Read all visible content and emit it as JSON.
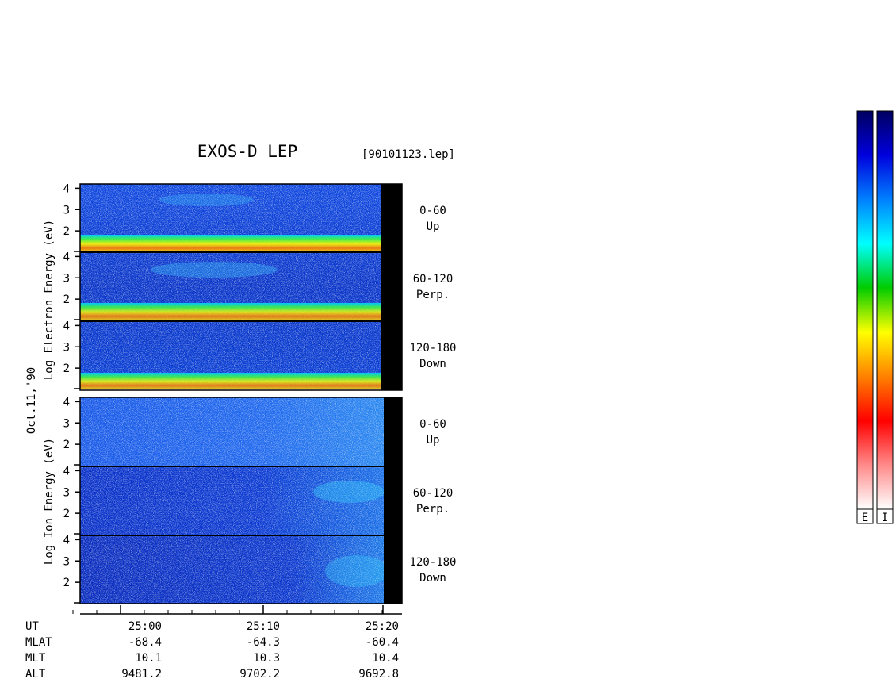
{
  "title": "EXOS-D LEP",
  "file_id": "[90101123.lep]",
  "date_label": "Oct.11,'90",
  "electron_ylabel": "Log Electron Energy (eV)",
  "ion_ylabel": "Log Ion Energy (eV)",
  "panels": [
    {
      "species": "electron",
      "pitch": "0-60",
      "direction": "Up"
    },
    {
      "species": "electron",
      "pitch": "60-120",
      "direction": "Perp."
    },
    {
      "species": "electron",
      "pitch": "120-180",
      "direction": "Down"
    },
    {
      "species": "ion",
      "pitch": "0-60",
      "direction": "Up"
    },
    {
      "species": "ion",
      "pitch": "60-120",
      "direction": "Perp."
    },
    {
      "species": "ion",
      "pitch": "120-180",
      "direction": "Down"
    }
  ],
  "colorbar_labels": [
    "E",
    "I"
  ],
  "colorbar_colors": [
    "#ffffff",
    "#ff8a8a",
    "#ff0000",
    "#ff8000",
    "#ffff00",
    "#00cc00",
    "#00ffff",
    "#0080ff",
    "#0000dd",
    "#000060"
  ],
  "chart_data": {
    "type": "heatmap",
    "title": "EXOS-D LEP",
    "x_ticks": [
      "25:00",
      "25:10",
      "25:20"
    ],
    "y_ticks": [
      "2",
      "3",
      "4"
    ],
    "ylim": [
      1,
      4.2
    ],
    "ephemeris": {
      "labels": [
        "UT",
        "MLAT",
        "MLT",
        "ALT"
      ],
      "rows": [
        [
          "25:00",
          "25:10",
          "25:20"
        ],
        [
          "-68.4",
          "-64.3",
          "-60.4"
        ],
        [
          "10.1",
          "10.3",
          "10.4"
        ],
        [
          "9481.2",
          "9702.2",
          "9692.8"
        ]
      ]
    }
  }
}
